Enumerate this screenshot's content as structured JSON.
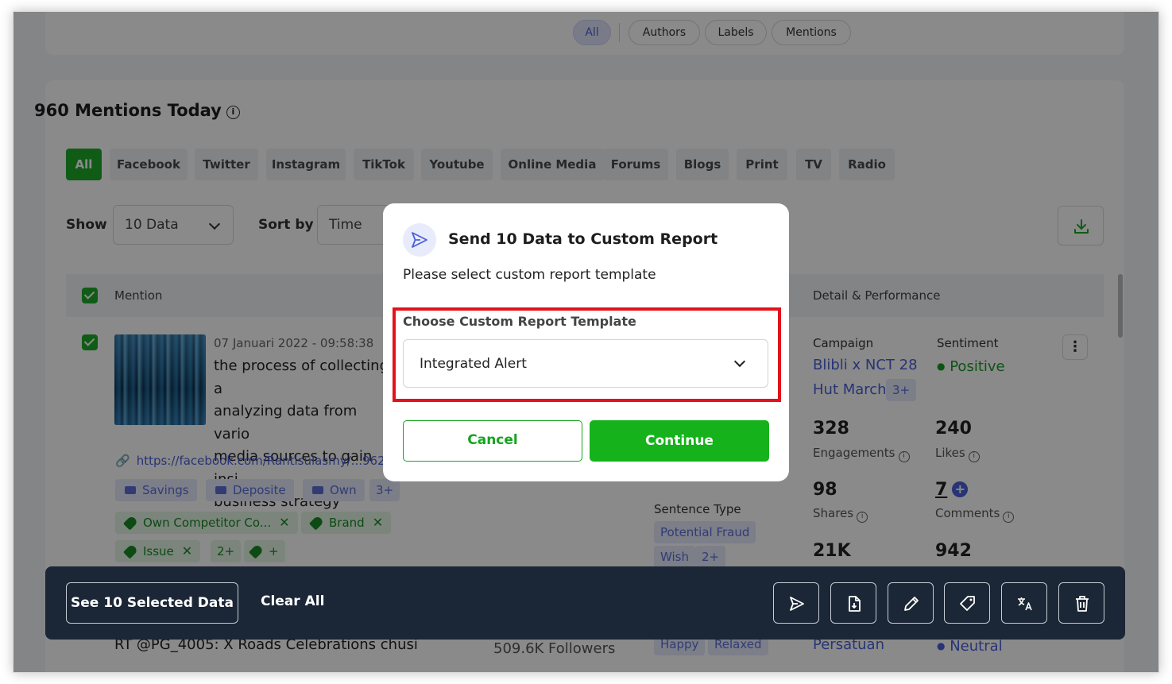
{
  "top_filters": [
    "All",
    "Authors",
    "Labels",
    "Mentions"
  ],
  "mentions_title": "960 Mentions Today",
  "channels": [
    "All",
    "Facebook",
    "Twitter",
    "Instagram",
    "TikTok",
    "Youtube",
    "Online Media",
    "Forums",
    "Blogs",
    "Print",
    "TV",
    "Radio"
  ],
  "controls": {
    "show_label": "Show",
    "show_value": "10 Data",
    "sort_label": "Sort by",
    "sort_value": "Time"
  },
  "table_headers": {
    "mention": "Mention",
    "detail": "Detail & Performance"
  },
  "mention": {
    "date": "07 Januari 2022 - 09:58:38",
    "text_lines": [
      "the process of collecting a",
      "analyzing data from vario",
      "media sources to gain insi",
      "business strategy"
    ],
    "link": "https://facebook.com/Rantisulasmy/...9621",
    "labels": [
      "Savings",
      "Deposite",
      "Own",
      "3+"
    ],
    "topics": [
      "Own Competitor Co...",
      "Brand",
      "Issue",
      "2+",
      "+"
    ],
    "sentence_type_label": "Sentence Type",
    "sentence_types": [
      "Potential Fraud",
      "Wish",
      "2+"
    ],
    "campaign_label": "Campaign",
    "campaign_values": [
      "Blibli x NCT 28",
      "Hut March",
      "3+"
    ],
    "sentiment_label": "Sentiment",
    "sentiment_value": "Positive",
    "engagements": "328",
    "engagements_label": "Engagements",
    "likes": "240",
    "likes_label": "Likes",
    "shares": "98",
    "shares_label": "Shares",
    "comments": "7",
    "comments_label": "Comments",
    "metric5": "21K",
    "metric6": "942"
  },
  "second_row": {
    "text": "RT @PG_4005: X Roads Celebrations chusi",
    "followers": "509.6K Followers",
    "emotions": [
      "Happy",
      "Relaxed"
    ],
    "campaign": "Persatuan",
    "sentiment": "Neutral"
  },
  "action_bar": {
    "see_selected": "See 10 Selected Data",
    "clear_all": "Clear All"
  },
  "modal": {
    "title": "Send 10 Data to Custom Report",
    "subtitle": "Please select custom report template",
    "field_label": "Choose Custom Report Template",
    "selected_template": "Integrated Alert",
    "cancel": "Cancel",
    "continue": "Continue"
  },
  "colors": {
    "primary_green": "#16b21c",
    "accent_blue": "#4a60d8",
    "highlight_red": "#e3121b",
    "action_bar": "#1b2636"
  }
}
